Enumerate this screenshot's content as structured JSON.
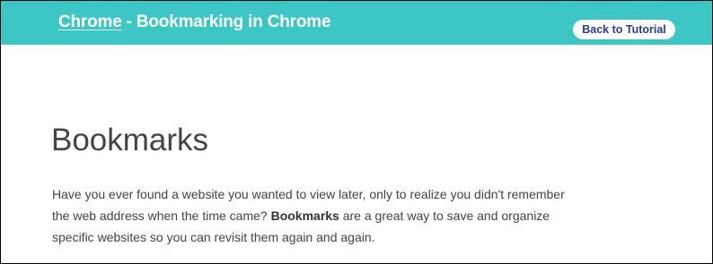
{
  "header": {
    "course_link": "Chrome",
    "title_rest": " - Bookmarking in Chrome",
    "back_button": "Back to Tutorial"
  },
  "main": {
    "heading": "Bookmarks",
    "intro_before": "Have you ever found a website you wanted to view later, only to realize you didn't remember the web address when the time came? ",
    "intro_bold": "Bookmarks",
    "intro_after": " are a great way to save and organize specific websites so you can revisit them again and again."
  },
  "colors": {
    "header_bg": "#3cc7c5",
    "header_text": "#ffffff",
    "button_text": "#2b3c8f",
    "body_text": "#444444"
  }
}
